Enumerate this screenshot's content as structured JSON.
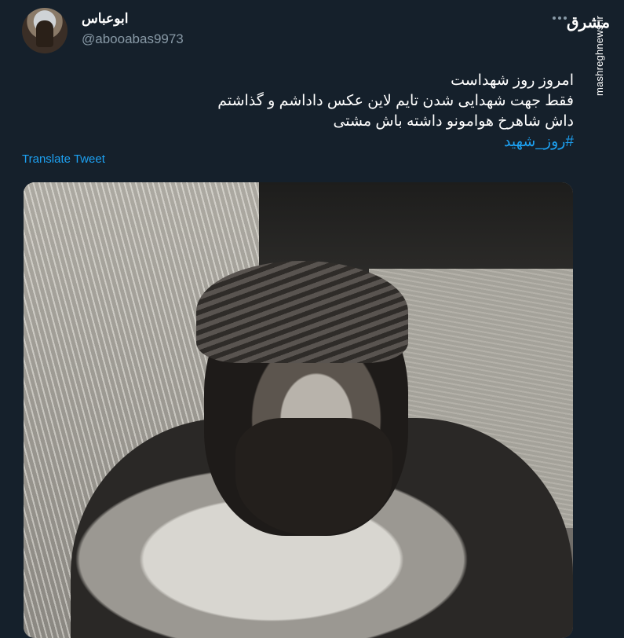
{
  "user": {
    "display_name": "ابوعباس",
    "handle": "@abooabas9973"
  },
  "tweet": {
    "lines": [
      "امروز روز شهداست",
      "فقط جهت شهدایی شدن تایم لاین عکس داداشم و گذاشتم",
      "داش شاهرخ هوامونو داشته باش مشتی"
    ],
    "hashtag": "#روز_شهید"
  },
  "translate_label": "Translate Tweet",
  "watermark": {
    "logo": "مشرق",
    "url": "mashreghnews.ir"
  },
  "icons": {
    "more": "more-icon",
    "avatar": "avatar"
  },
  "colors": {
    "background": "#15202b",
    "secondary_text": "#8899a6",
    "link": "#1da1f2"
  }
}
